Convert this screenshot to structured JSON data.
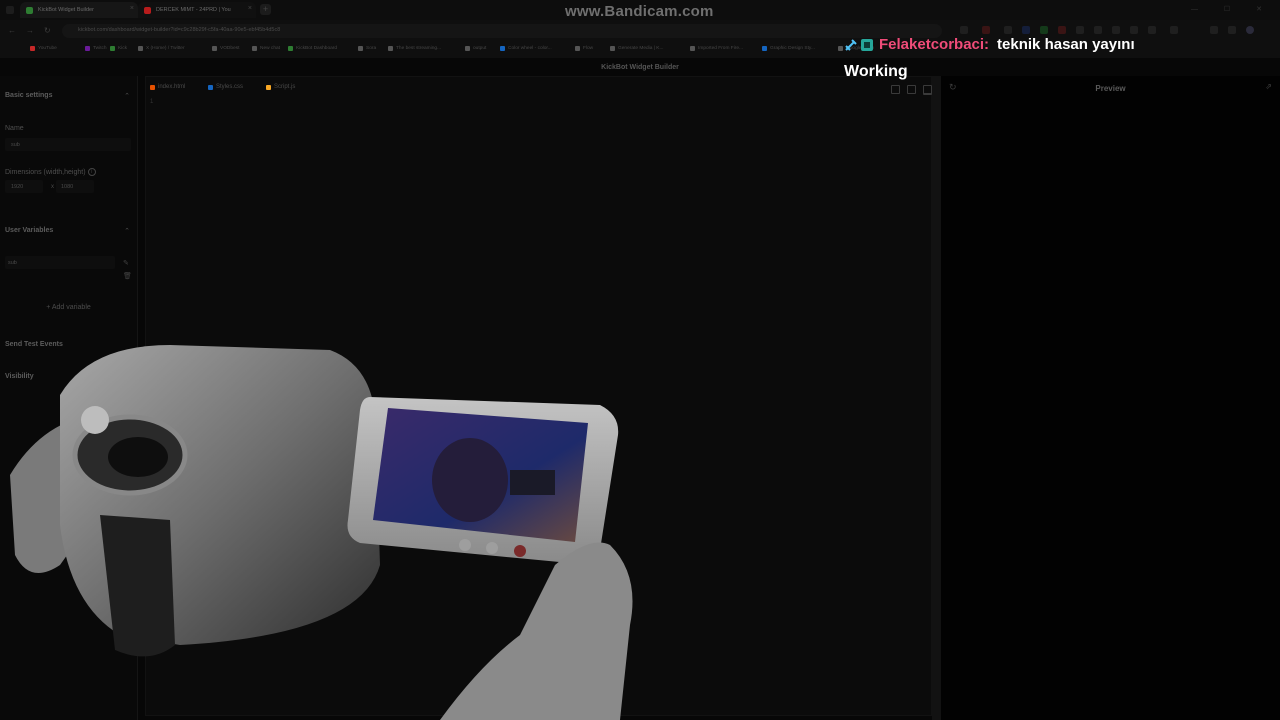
{
  "browser": {
    "tabs": [
      {
        "title": "KickBot Widget Builder",
        "favicon_color": "#2e7d32"
      },
      {
        "title": "DERCEK MIMT - 24PRD | You",
        "favicon_color": "#b71c1c"
      }
    ],
    "watermark": "www.Bandicam.com",
    "url": "kickbot.com/dashboard/widget-builder?id=c9c28b29f-c5fa-40aa-90e5-ebf45b4d5c8",
    "bookmarks": [
      {
        "label": "YouTube",
        "color": "#c62828"
      },
      {
        "label": "Twitch",
        "color": "#6a1b9a"
      },
      {
        "label": "Kick",
        "color": "#2e7d32"
      },
      {
        "label": "X (Home) / Twitter",
        "color": "#555555"
      },
      {
        "label": "VODbest",
        "color": "#555555"
      },
      {
        "label": "New chat",
        "color": "#555555"
      },
      {
        "label": "KickBot Dashboard",
        "color": "#2e7d32"
      },
      {
        "label": "Sora",
        "color": "#555555"
      },
      {
        "label": "The best streaming...",
        "color": "#555555"
      },
      {
        "label": "output",
        "color": "#555555"
      },
      {
        "label": "Color wheel - color...",
        "color": "#1565c0"
      },
      {
        "label": "Flow",
        "color": "#555555"
      },
      {
        "label": "Generate Media | K...",
        "color": "#555555"
      },
      {
        "label": "Imported From Fire...",
        "color": "#555555"
      },
      {
        "label": "Graphic Design Sty...",
        "color": "#1565c0"
      },
      {
        "label": "Google Keep",
        "color": "#555555"
      }
    ]
  },
  "app": {
    "title": "KickBot Widget Builder",
    "sidebar": {
      "basic_settings": "Basic settings",
      "name_label": "Name",
      "name_value": "sub",
      "dimensions_label": "Dimensions (width,height)",
      "width_value": "1920",
      "times": "x",
      "height_value": "1080",
      "user_variables": "User Variables",
      "variable_value": "sub",
      "add_variable": "Add variable",
      "send_test_events": "Send Test Events",
      "visibility": "Visibility"
    },
    "editor": {
      "files": [
        {
          "name": "index.html",
          "color": "#e65100"
        },
        {
          "name": "Styles.css",
          "color": "#1565c0"
        },
        {
          "name": "Script.js",
          "color": "#f9a825"
        }
      ],
      "line_number": "1"
    },
    "preview": {
      "title": "Preview"
    }
  },
  "overlay": {
    "chat_user": "Felaketcorbaci:",
    "chat_message": "teknik hasan yayını",
    "status": "Working"
  }
}
